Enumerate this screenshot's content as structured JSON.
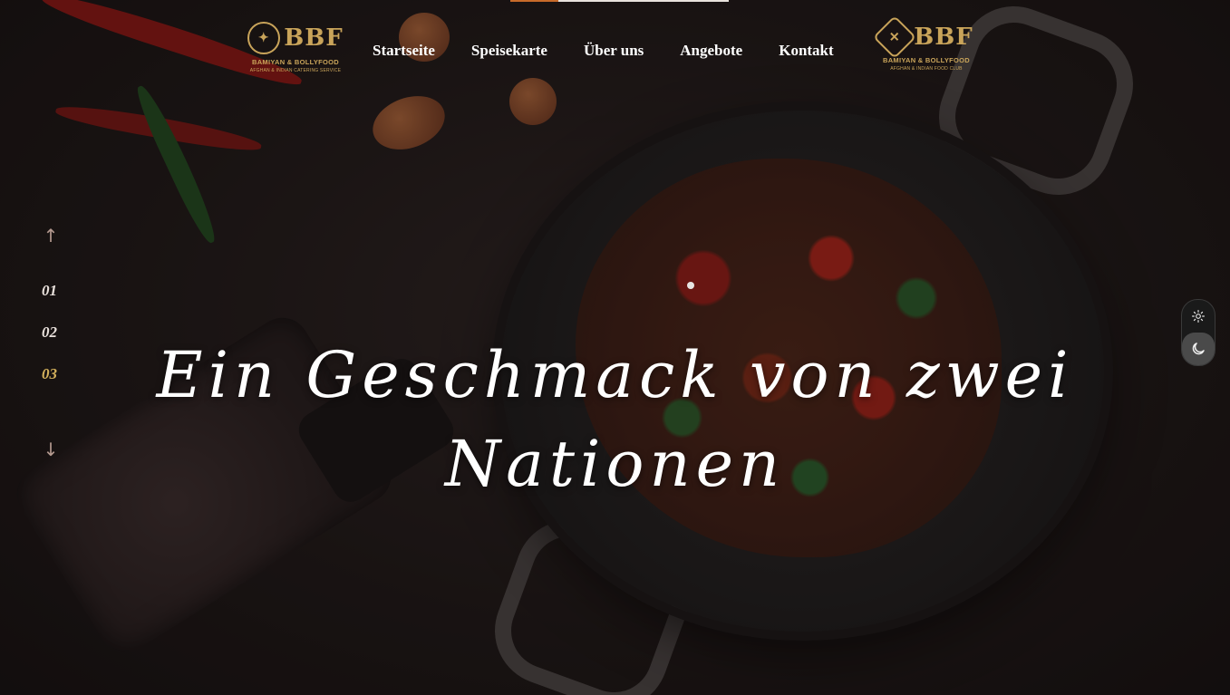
{
  "brand": {
    "left_logo": {
      "mark": "BBF",
      "name": "BAMIYAN & BOLLYFOOD",
      "tagline": "AFGHAN & INDIAN CATERING SERVICE"
    },
    "right_logo": {
      "mark": "BBF",
      "name": "BAMIYAN & BOLLYFOOD",
      "tagline": "AFGHAN & INDIAN FOOD CLUB"
    }
  },
  "nav": {
    "items": [
      {
        "label": "Startseite"
      },
      {
        "label": "Speisekarte"
      },
      {
        "label": "Über uns"
      },
      {
        "label": "Angebote"
      },
      {
        "label": "Kontakt"
      }
    ]
  },
  "slider": {
    "up_icon": "arrow-up-icon",
    "down_icon": "arrow-down-icon",
    "slides": [
      "01",
      "02",
      "03"
    ],
    "active_index": 2
  },
  "hero": {
    "headline": "Ein Geschmack von zwei Nationen"
  },
  "theme": {
    "light_icon": "sun-icon",
    "dark_icon": "moon-icon",
    "active": "dark"
  },
  "colors": {
    "accent_gold": "#d4b15c",
    "logo_gold": "#c9a45a",
    "nav_text": "#ffffff",
    "background": "#1d1716"
  }
}
